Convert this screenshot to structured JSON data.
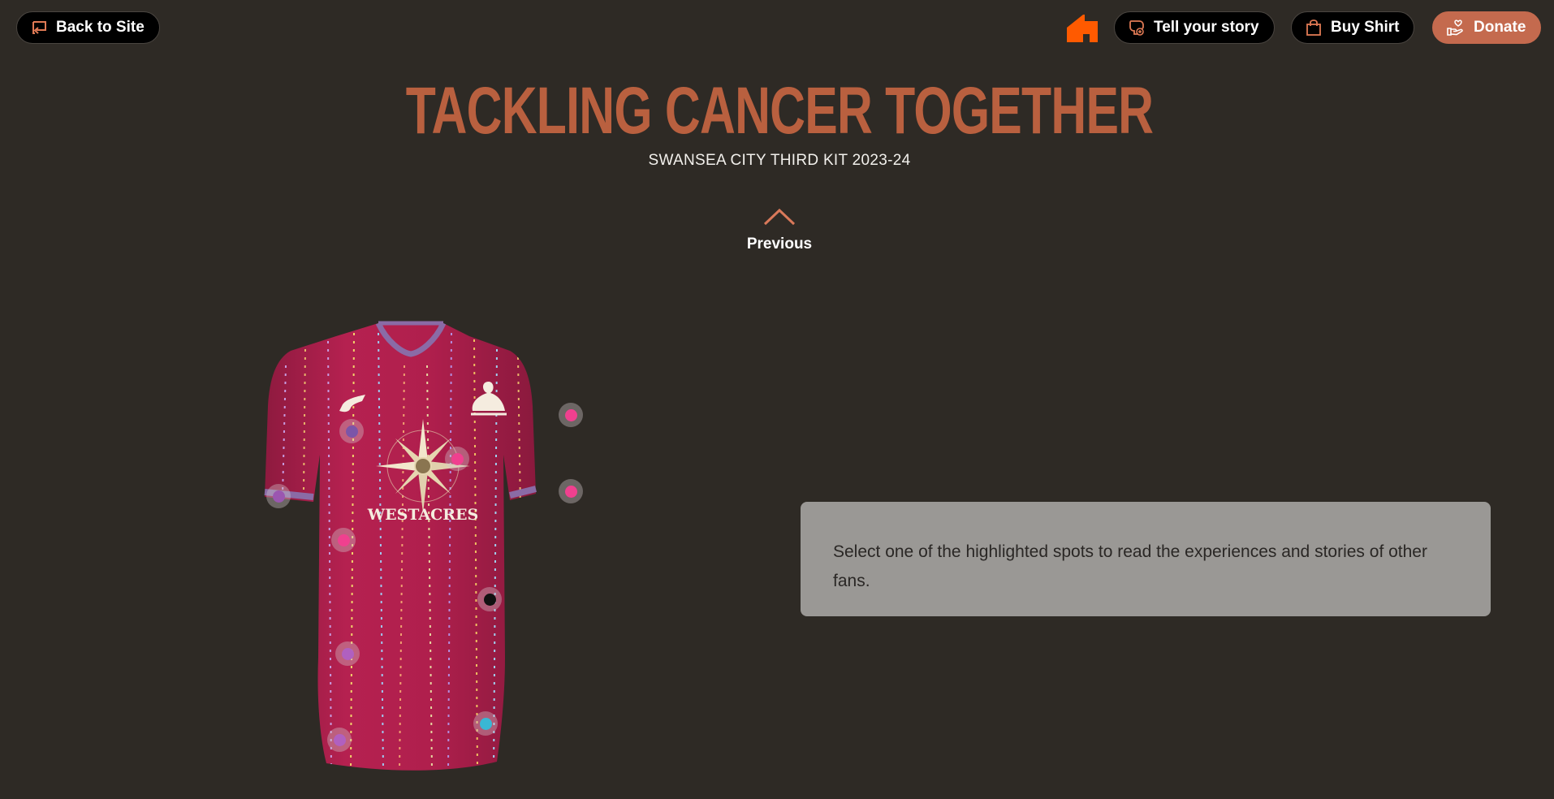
{
  "nav": {
    "back_label": "Back to Site",
    "story_label": "Tell your story",
    "buy_label": "Buy Shirt",
    "donate_label": "Donate",
    "accent_color": "#c46a4e",
    "home_icon_color": "#ff5a00"
  },
  "header": {
    "title": "TACKLING CANCER TOGETHER",
    "subtitle": "SWANSEA CITY THIRD KIT 2023-24",
    "title_color": "#b9603f"
  },
  "pager": {
    "previous_label": "Previous"
  },
  "shirt": {
    "sponsor_text": "WESTACRES",
    "color": "#b52150",
    "hotspots": [
      {
        "name": "hotspot-1",
        "color": "#7c55a8"
      },
      {
        "name": "hotspot-2",
        "color": "#f0408f"
      },
      {
        "name": "hotspot-3",
        "color": "#f0408f"
      },
      {
        "name": "hotspot-4",
        "color": "#9b56b0"
      },
      {
        "name": "hotspot-5",
        "color": "#f0408f"
      },
      {
        "name": "hotspot-6",
        "color": "#f0408f"
      },
      {
        "name": "hotspot-7",
        "color": "#111111"
      },
      {
        "name": "hotspot-8",
        "color": "#b060c0"
      },
      {
        "name": "hotspot-9",
        "color": "#39b7d4"
      },
      {
        "name": "hotspot-10",
        "color": "#b060c0"
      }
    ]
  },
  "info": {
    "message": "Select one of the highlighted spots to read the experiences and stories of other fans."
  }
}
